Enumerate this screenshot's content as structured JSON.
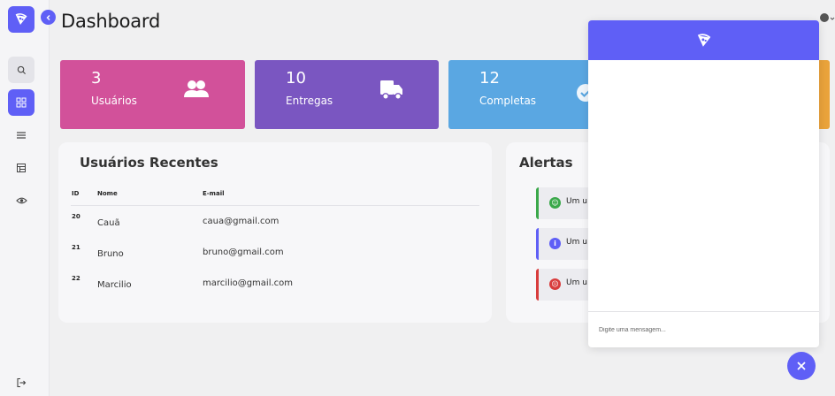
{
  "header": {
    "title": "Dashboard"
  },
  "cards": [
    {
      "value": "3",
      "label": "Usuários",
      "icon": "users-icon",
      "color": "#d2519a"
    },
    {
      "value": "10",
      "label": "Entregas",
      "icon": "truck-icon",
      "color": "#7a56c1"
    },
    {
      "value": "12",
      "label": "Completas",
      "icon": "check-circle-icon",
      "color": "#5aa7e2"
    },
    {
      "color": "#eaa33b"
    }
  ],
  "recent_users": {
    "title": "Usuários Recentes",
    "columns": [
      "ID",
      "Nome",
      "E-mail"
    ],
    "rows": [
      {
        "id": "20",
        "nome": "Cauã",
        "email": "caua@gmail.com"
      },
      {
        "id": "21",
        "nome": "Bruno",
        "email": "bruno@gmail.com"
      },
      {
        "id": "22",
        "nome": "Marcilio",
        "email": "marcilio@gmail.com"
      }
    ]
  },
  "alerts": {
    "title": "Alertas",
    "items": [
      {
        "text": "Um u",
        "icon": "smile-icon",
        "color": "#3aa84a"
      },
      {
        "text": "Um u",
        "icon": "info-icon",
        "color": "#5f5ff6"
      },
      {
        "text": "Um u",
        "icon": "sad-icon",
        "color": "#d83c3c"
      }
    ]
  },
  "chat": {
    "placeholder": "Digite uma mensagem..."
  },
  "sidebar": {
    "items": [
      "search-icon",
      "dashboard-icon",
      "list-icon",
      "table-icon",
      "eye-icon"
    ],
    "footer": "logout-icon"
  },
  "colors": {
    "accent": "#5f5ff6"
  }
}
